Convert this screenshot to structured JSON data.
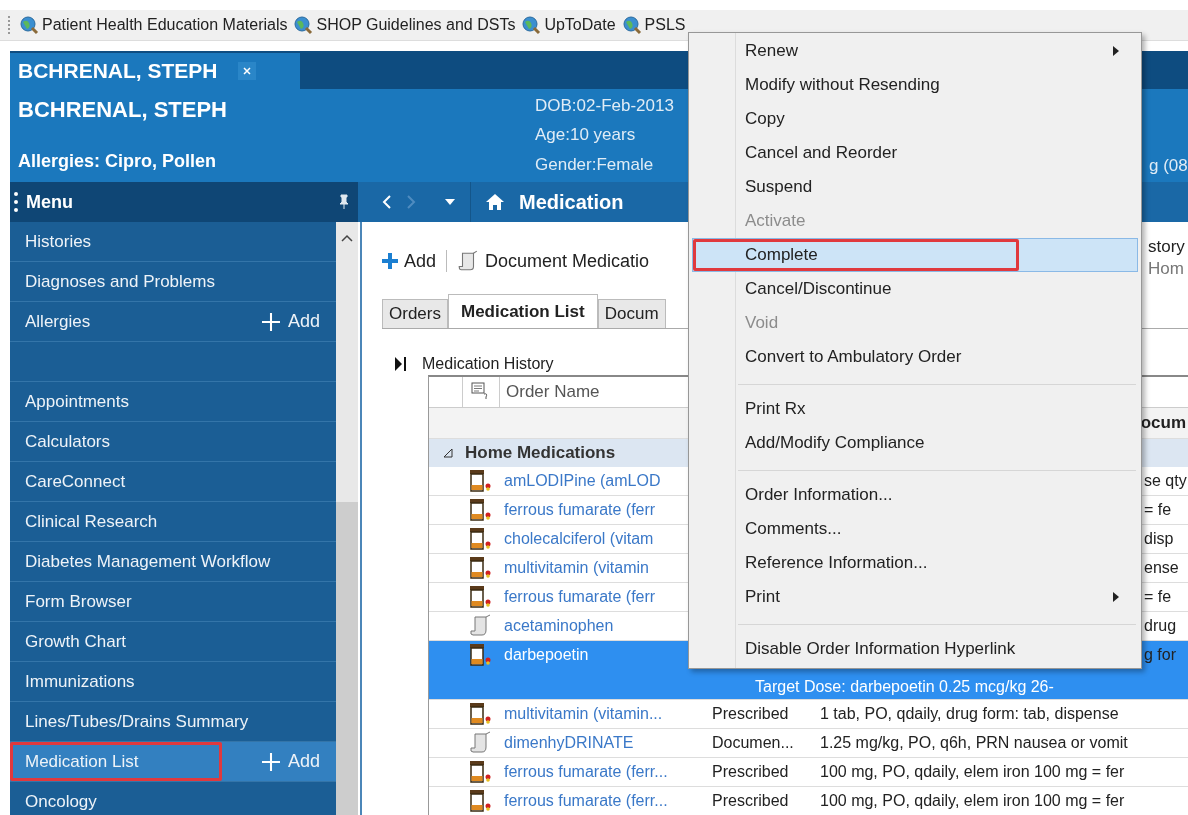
{
  "toolbar_links": [
    {
      "label": "Patient Health Education Materials"
    },
    {
      "label": "SHOP Guidelines and DSTs"
    },
    {
      "label": "UpToDate"
    },
    {
      "label": "PSLS"
    }
  ],
  "patient_tab": {
    "label": "BCHRENAL, STEPH"
  },
  "banner": {
    "name": "BCHRENAL, STEPH",
    "allergies": "Allergies: Cipro, Pollen",
    "dob": "DOB:02-Feb-2013",
    "age": "Age:10 years",
    "gender": "Gender:Female",
    "column_3": "g (08"
  },
  "sidebar": {
    "title": "Menu",
    "items": [
      {
        "kind": "link",
        "label": "Histories",
        "selected": false,
        "annotated": false
      },
      {
        "kind": "link",
        "label": "Diagnoses and Problems",
        "selected": false,
        "annotated": false
      },
      {
        "kind": "link",
        "label": "Allergies",
        "action": "Add",
        "selected": false,
        "annotated": false
      },
      {
        "kind": "blank",
        "selected": false,
        "annotated": false
      },
      {
        "kind": "link",
        "label": "Appointments",
        "selected": false,
        "annotated": false
      },
      {
        "kind": "link",
        "label": "Calculators",
        "selected": false,
        "annotated": false
      },
      {
        "kind": "link",
        "label": "CareConnect",
        "selected": false,
        "annotated": false
      },
      {
        "kind": "link",
        "label": "Clinical Research",
        "selected": false,
        "annotated": false
      },
      {
        "kind": "link",
        "label": "Diabetes Management Workflow",
        "selected": false,
        "annotated": false
      },
      {
        "kind": "link",
        "label": "Form Browser",
        "selected": false,
        "annotated": false
      },
      {
        "kind": "link",
        "label": "Growth Chart",
        "selected": false,
        "annotated": false
      },
      {
        "kind": "link",
        "label": "Immunizations",
        "selected": false,
        "annotated": false
      },
      {
        "kind": "link",
        "label": "Lines/Tubes/Drains Summary",
        "selected": false,
        "annotated": false
      },
      {
        "kind": "link",
        "label": "Medication List",
        "action": "Add",
        "selected": true,
        "annotated": true
      },
      {
        "kind": "link",
        "label": "Oncology",
        "selected": false,
        "annotated": false
      }
    ]
  },
  "nav": {
    "title": "Medication"
  },
  "content_toolbar": {
    "add": "Add",
    "document": "Document Medicatio",
    "right_top": "story",
    "right_bottom": "Hom"
  },
  "tabs": [
    {
      "label": "Orders",
      "selected": false
    },
    {
      "label": "Medication List",
      "selected": true
    },
    {
      "label": "Docum",
      "selected": false
    }
  ],
  "section_title": "Medication History",
  "table": {
    "columns": [
      "Order Name"
    ],
    "header_tail": "ocum",
    "group": "Home Medications",
    "rows": [
      {
        "kind": "prescribed",
        "name": "amLODIPine (amLOD",
        "tail": "se qty",
        "selected": false
      },
      {
        "kind": "prescribed",
        "name": "ferrous fumarate (ferr",
        "tail": "= fe",
        "selected": false
      },
      {
        "kind": "prescribed",
        "name": "cholecalciferol (vitam",
        "tail": "disp",
        "selected": false
      },
      {
        "kind": "prescribed",
        "name": "multivitamin (vitamin",
        "tail": "ense",
        "selected": false
      },
      {
        "kind": "prescribed",
        "name": "ferrous fumarate (ferr",
        "tail": "= fe",
        "selected": false
      },
      {
        "kind": "documented",
        "name": "acetaminophen",
        "tail": "drug",
        "selected": false
      },
      {
        "kind": "prescribed",
        "name": "darbepoetin",
        "tail": "g for",
        "note": "Target Dose: darbepoetin 0.25 mcg/kg  26-",
        "selected": true
      },
      {
        "kind": "prescribed",
        "name": "multivitamin (vitamin...",
        "status": "Prescribed",
        "details": "1 tab, PO, qdaily, drug form: tab, dispense",
        "selected": false
      },
      {
        "kind": "documented",
        "name": "dimenhyDRINATE",
        "status": "Documen...",
        "details": "1.25 mg/kg, PO, q6h, PRN nausea or vomit",
        "selected": false
      },
      {
        "kind": "prescribed",
        "name": "ferrous fumarate (ferr...",
        "status": "Prescribed",
        "details": "100 mg, PO, qdaily, elem iron 100 mg = fer",
        "selected": false
      },
      {
        "kind": "prescribed",
        "name": "ferrous fumarate (ferr...",
        "status": "Prescribed",
        "details": "100 mg, PO, qdaily, elem iron 100 mg = fer",
        "selected": false
      }
    ]
  },
  "context_menu": [
    {
      "label": "Renew",
      "disabled": false,
      "submenu": true,
      "highlighted": false,
      "annotated": false,
      "separator_before": false
    },
    {
      "label": "Modify without Resending",
      "disabled": false,
      "submenu": false,
      "highlighted": false,
      "annotated": false,
      "separator_before": false
    },
    {
      "label": "Copy",
      "disabled": false,
      "submenu": false,
      "highlighted": false,
      "annotated": false,
      "separator_before": false
    },
    {
      "label": "Cancel and Reorder",
      "disabled": false,
      "submenu": false,
      "highlighted": false,
      "annotated": false,
      "separator_before": false
    },
    {
      "label": "Suspend",
      "disabled": false,
      "submenu": false,
      "highlighted": false,
      "annotated": false,
      "separator_before": false
    },
    {
      "label": "Activate",
      "disabled": true,
      "submenu": false,
      "highlighted": false,
      "annotated": false,
      "separator_before": false
    },
    {
      "label": "Complete",
      "disabled": false,
      "submenu": false,
      "highlighted": true,
      "annotated": true,
      "separator_before": false
    },
    {
      "label": "Cancel/Discontinue",
      "disabled": false,
      "submenu": false,
      "highlighted": false,
      "annotated": false,
      "separator_before": false
    },
    {
      "label": "Void",
      "disabled": true,
      "submenu": false,
      "highlighted": false,
      "annotated": false,
      "separator_before": false
    },
    {
      "label": "Convert to Ambulatory Order",
      "disabled": false,
      "submenu": false,
      "highlighted": false,
      "annotated": false,
      "separator_before": false
    },
    {
      "label": "Print Rx",
      "disabled": false,
      "submenu": false,
      "highlighted": false,
      "annotated": false,
      "separator_before": true
    },
    {
      "label": "Add/Modify Compliance",
      "disabled": false,
      "submenu": false,
      "highlighted": false,
      "annotated": false,
      "separator_before": false
    },
    {
      "label": "Order Information...",
      "disabled": false,
      "submenu": false,
      "highlighted": false,
      "annotated": false,
      "separator_before": true
    },
    {
      "label": "Comments...",
      "disabled": false,
      "submenu": false,
      "highlighted": false,
      "annotated": false,
      "separator_before": false
    },
    {
      "label": "Reference Information...",
      "disabled": false,
      "submenu": false,
      "highlighted": false,
      "annotated": false,
      "separator_before": false
    },
    {
      "label": "Print",
      "disabled": false,
      "submenu": true,
      "highlighted": false,
      "annotated": false,
      "separator_before": false
    },
    {
      "label": "Disable Order Information Hyperlink",
      "disabled": false,
      "submenu": false,
      "highlighted": false,
      "annotated": false,
      "separator_before": true
    }
  ]
}
